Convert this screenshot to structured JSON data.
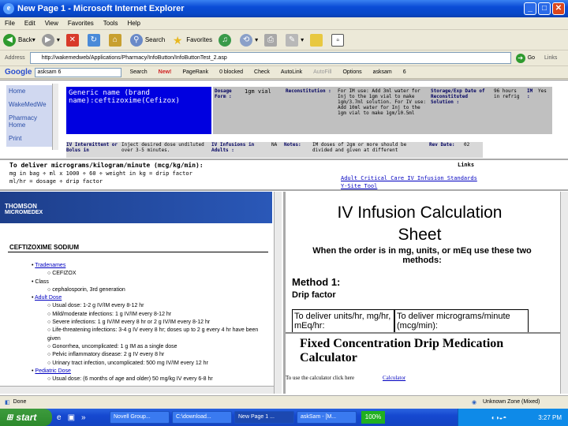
{
  "window": {
    "title": "New Page 1 - Microsoft Internet Explorer",
    "logo": "e"
  },
  "menu": [
    "File",
    "Edit",
    "View",
    "Favorites",
    "Tools",
    "Help"
  ],
  "toolbar": {
    "back": "Back",
    "search": "Search",
    "favorites": "Favorites"
  },
  "address": {
    "label": "Address",
    "url": "http://wakemedweb/Applications/Pharmacy/InfoButton/InfoButtonTest_2.asp",
    "go": "Go",
    "links": "Links"
  },
  "google_bar": {
    "logo": "Google",
    "query": "asksam 6",
    "search": "Search",
    "new": "New!",
    "pagerank": "PageRank",
    "blocked": "0 blocked",
    "check": "Check",
    "autolink": "AutoLink",
    "autofill": "AutoFill",
    "options": "Options",
    "asksam": "asksam",
    "six": "6"
  },
  "left_nav": [
    "Home",
    "WakeMedWe",
    "Pharmacy Home",
    "Print"
  ],
  "table": {
    "generic_name": "Generic name (brand name):ceftizoxime(Cefizox)",
    "dosage_form_label": "Dosage Form :",
    "dosage_form_value": "1gm vial",
    "reconstitution_label": "Reconstitution :",
    "reconstitution_value": "For IM use: Add 3ml water for Inj to the 1gm vial to make 1gm/3.7ml solution. For IV use: Add 10ml water for Inj to the 1gm vial to make 1gm/10.5ml",
    "storage_label": "Storage/Exp Date of Reconstituted Solution :",
    "storage_value": "96 hours in refrig",
    "im_label": "IM :",
    "im_value": "Yes",
    "iv_intermittent_label": "IV Intermittent or Bolus in",
    "iv_intermittent_value": "Inject desired dose undiluted over 3-5 minutes.",
    "iv_infusions_label": "IV Infusions in Adults :",
    "iv_infusions_value": "NA",
    "notes_label": "Notes:",
    "notes_value": "IM doses of 2gm or more should be divided and given at different",
    "rev_label": "Rev Date:",
    "rev_value": "02"
  },
  "formula": {
    "title": "To deliver micrograms/kilogram/minute (mcg/kg/min):",
    "line1": "mg in bag ÷ ml x 1000 ÷ 60 ÷ weight in kg = drip factor",
    "line2": "ml/hr = dosage ÷ drip factor",
    "links_label": "Links",
    "link1": "Adult Critical Care IV Infusion Standards",
    "link2": "Y-Site Tool"
  },
  "micromedex": {
    "brand1": "THOMSON",
    "brand2": "MICROMEDEX",
    "drug": "CEFTIZOXIME SODIUM",
    "items": [
      {
        "text": "Tradenames",
        "level": 1,
        "link": true
      },
      {
        "text": "CEFIZOX",
        "level": 2,
        "link": false
      },
      {
        "text": "Class",
        "level": 1,
        "link": false
      },
      {
        "text": "cephalosporin, 3rd generation",
        "level": 2,
        "link": false
      },
      {
        "text": "Adult Dose",
        "level": 1,
        "link": true
      },
      {
        "text": "Usual dose: 1-2 g IV/IM every 8-12 hr",
        "level": 2,
        "link": false
      },
      {
        "text": "Mild/moderate infections: 1 g IV/IM every 8-12 hr",
        "level": 2,
        "link": false
      },
      {
        "text": "Severe infections: 1 g IV/IM every 8 hr or 2 g IV/IM every 8-12 hr",
        "level": 2,
        "link": false
      },
      {
        "text": "Life-threatening infections: 3-4 g IV every 8 hr; doses up to 2 g every 4 hr have been given",
        "level": 2,
        "link": false
      },
      {
        "text": "Gonorrhea, uncomplicated: 1 g IM as a single dose",
        "level": 2,
        "link": false
      },
      {
        "text": "Pelvic inflammatory disease: 2 g IV every 8 hr",
        "level": 2,
        "link": false
      },
      {
        "text": "Urinary tract infection, uncomplicated: 500 mg IV/IM every 12 hr",
        "level": 2,
        "link": false
      },
      {
        "text": "Pediatric Dose",
        "level": 1,
        "link": true
      },
      {
        "text": "Usual dose: (6 months of age and older) 50 mg/kg IV every 6-8 hr",
        "level": 2,
        "link": false
      }
    ]
  },
  "iv_sheet": {
    "title1": "IV Infusion Calculation",
    "title2": "Sheet",
    "intro": "When the order is in mg, units, or mEq use these two methods:",
    "method": "Method 1:",
    "drip": "Drip factor",
    "col1": "To deliver units/hr, mg/hr, mEq/hr:",
    "col2": "To deliver micrograms/minute (mcg/min):"
  },
  "calculator": {
    "title": "Fixed Concentration Drip Medication Calculator",
    "hint": "To use the calculator click here",
    "link": "Calculator"
  },
  "status": {
    "text": "Done",
    "zone": "Unknown Zone (Mixed)"
  },
  "taskbar": {
    "start": "start",
    "tasks": [
      "Novell Group...",
      "C:\\download...",
      "New Page 1 ...",
      "askSam - [M..."
    ],
    "progress": "100%",
    "clock": "3:27 PM"
  }
}
